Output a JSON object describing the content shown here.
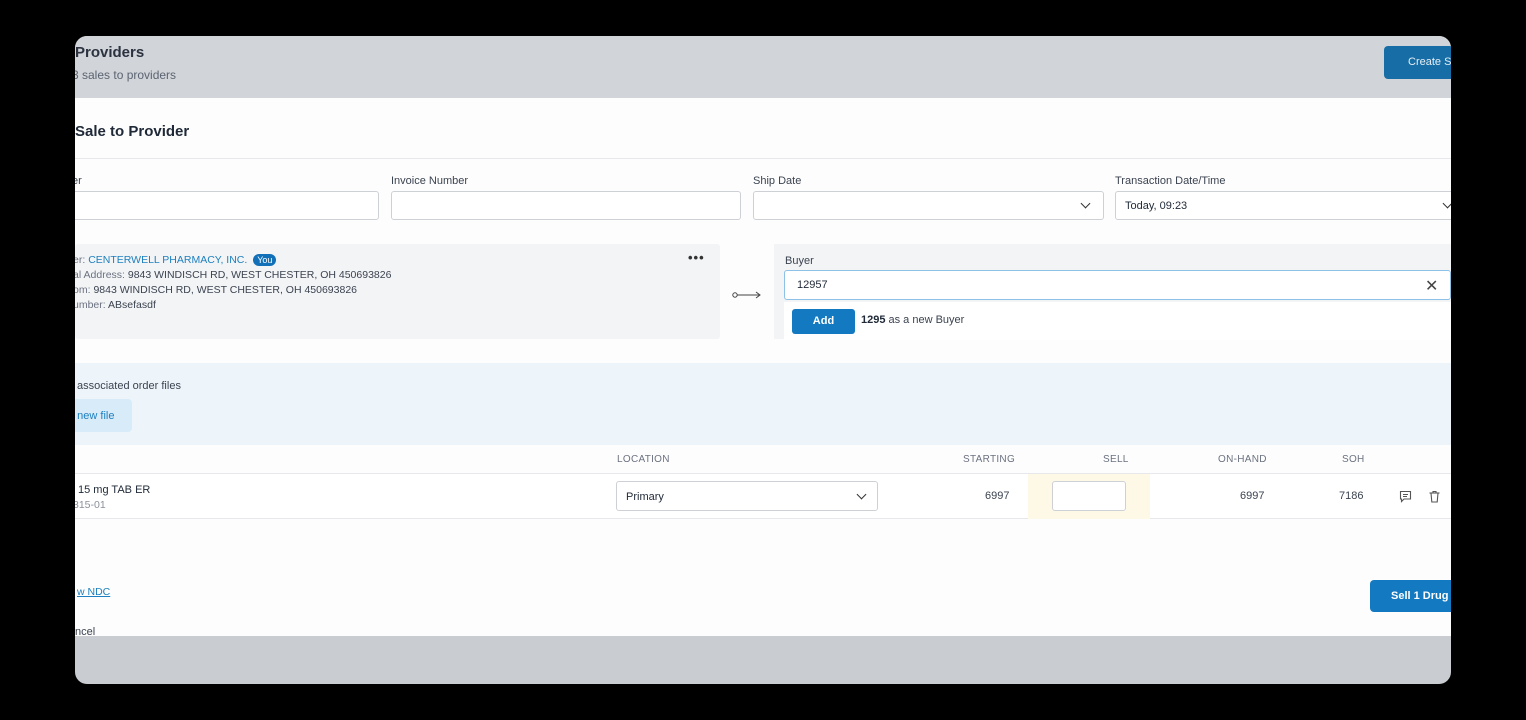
{
  "background": {
    "title": "Providers",
    "subtitle": "3 sales to providers",
    "create_button": "Create S"
  },
  "modal": {
    "title": "Sale to Provider",
    "fields": {
      "first_label": "er",
      "invoice_label": "Invoice Number",
      "ship_label": "Ship Date",
      "txn_label": "Transaction Date/Time",
      "txn_value": "Today, 09:23"
    },
    "seller": {
      "label1": "er:",
      "name": "CENTERWELL PHARMACY, INC.",
      "you_badge": "You",
      "label2": "al Address:",
      "address": "9843 WINDISCH RD, WEST CHESTER, OH 450693826",
      "label3": "om:",
      "ship_from": "9843 WINDISCH RD, WEST CHESTER, OH 450693826",
      "label4": "umber:",
      "number": "ABsefasdf",
      "more": "•••"
    },
    "buyer": {
      "label": "Buyer",
      "input_value": "12957",
      "clear": "✕",
      "add_button": "Add",
      "add_value": "1295",
      "add_suffix": "as a new Buyer"
    },
    "files": {
      "label": "associated order files",
      "new_file": "d new file"
    },
    "table": {
      "headers": {
        "location": "LOCATION",
        "starting": "STARTING",
        "sell": "SELL",
        "onhand": "ON-HAND",
        "soh": "SOH"
      },
      "row": {
        "drug_name": "15 mg TAB ER",
        "drug_code": "315-01",
        "location": "Primary",
        "starting": "6997",
        "sell": "",
        "onhand": "6997",
        "soh": "7186"
      }
    },
    "ndc_link": "w NDC",
    "cancel": "ncel",
    "sell_button": "Sell 1 Drug"
  }
}
